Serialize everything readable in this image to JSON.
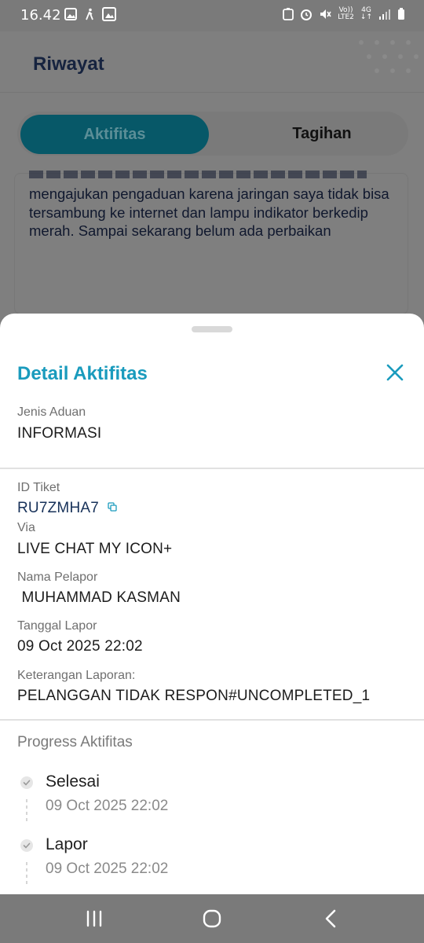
{
  "status_bar": {
    "time": "16.42",
    "network_top": "Vo))",
    "network_bottom": "LTE2",
    "net_type_top": "4G",
    "net_type_bottom": "↓↑"
  },
  "background": {
    "title": "Riwayat",
    "tabs": [
      {
        "label": "Aktifitas",
        "active": true
      },
      {
        "label": "Tagihan",
        "active": false
      }
    ],
    "card_text": "mengajukan pengaduan karena jaringan saya tidak bisa tersambung ke internet dan lampu indikator berkedip merah. Sampai sekarang belum ada perbaikan"
  },
  "sheet": {
    "title": "Detail Aktifitas",
    "jenis_label": "Jenis Aduan",
    "jenis_value": "INFORMASI",
    "id_label": "ID Tiket",
    "id_value": "RU7ZMHA7",
    "via_label": "Via",
    "via_value": "LIVE CHAT MY ICON+",
    "pelapor_label": "Nama Pelapor",
    "pelapor_value": " MUHAMMAD KASMAN",
    "tanggal_label": "Tanggal Lapor",
    "tanggal_value": "09 Oct 2025 22:02",
    "keterangan_label": "Keterangan Laporan:",
    "keterangan_value": "PELANGGAN TIDAK RESPON#UNCOMPLETED_1",
    "progress_title": "Progress Aktifitas",
    "steps": [
      {
        "title": "Selesai",
        "date": "09 Oct 2025 22:02"
      },
      {
        "title": "Lapor",
        "date": "09 Oct 2025 22:02"
      }
    ]
  },
  "colors": {
    "accent": "#1a9bbd",
    "ticket_text": "#173159",
    "scrim": "#7f7f7f",
    "active_tab": "#075868"
  },
  "icons": {
    "close": "close-icon",
    "copy": "copy-icon",
    "check": "check-icon",
    "nav_recents": "recents-icon",
    "nav_home": "home-icon",
    "nav_back": "back-icon"
  }
}
